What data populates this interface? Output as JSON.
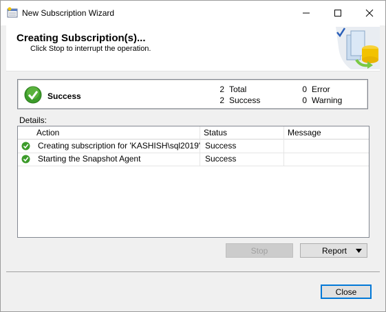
{
  "window": {
    "title": "New Subscription Wizard"
  },
  "banner": {
    "title": "Creating Subscription(s)...",
    "subtitle": "Click Stop to interrupt the operation."
  },
  "summary": {
    "status": "Success",
    "total_count": "2",
    "total_label": "Total",
    "success_count": "2",
    "success_label": "Success",
    "error_count": "0",
    "error_label": "Error",
    "warning_count": "0",
    "warning_label": "Warning"
  },
  "details": {
    "label": "Details:",
    "columns": [
      "Action",
      "Status",
      "Message"
    ],
    "rows": [
      {
        "icon": "success-icon",
        "action": "Creating subscription for 'KASHISH\\sql2019'",
        "status": "Success",
        "message": ""
      },
      {
        "icon": "success-icon",
        "action": "Starting the Snapshot Agent",
        "status": "Success",
        "message": ""
      }
    ]
  },
  "buttons": {
    "stop": "Stop",
    "report": "Report",
    "close": "Close"
  },
  "colors": {
    "success": "#3c9b2a",
    "accent": "#0078d7"
  }
}
